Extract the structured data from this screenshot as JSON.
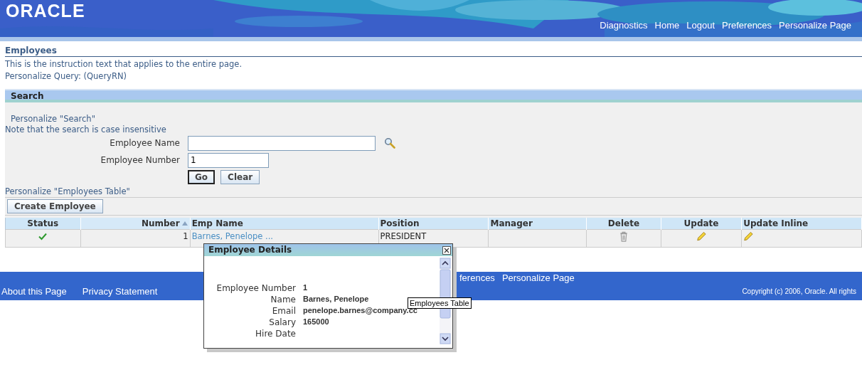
{
  "header": {
    "logo": "ORACLE",
    "links": [
      "Diagnostics",
      "Home",
      "Logout",
      "Preferences",
      "Personalize Page"
    ]
  },
  "page": {
    "title": "Employees",
    "instruction": "This is the instruction text that applies to the entire page.",
    "personalize_query": "Personalize Query: (QueryRN)"
  },
  "search": {
    "title": "Search",
    "personalize": "Personalize \"Search\"",
    "note": "Note that the search is case insensitive",
    "fields": [
      {
        "label": "Employee Name",
        "kind": "lookup"
      },
      {
        "label": "Employee Number",
        "value": "1",
        "kind": "text"
      }
    ],
    "buttons": [
      {
        "label": "Go",
        "default": true
      },
      {
        "label": "Clear",
        "default": false
      }
    ]
  },
  "table": {
    "personalize": "Personalize \"Employees Table\"",
    "create_button": "Create Employee",
    "columns": [
      {
        "label": "Status",
        "sorted": false
      },
      {
        "label": "Number",
        "sorted": true
      },
      {
        "label": "Emp Name",
        "sorted": false
      },
      {
        "label": "Position",
        "sorted": false
      },
      {
        "label": "Manager",
        "sorted": false
      },
      {
        "label": "Delete",
        "sorted": false
      },
      {
        "label": "Update",
        "sorted": false
      },
      {
        "label": "Update Inline",
        "sorted": false
      }
    ],
    "rows": [
      {
        "status": true,
        "number": "1",
        "emp_name": "Barnes, Penelope ...",
        "position": "PRESIDENT",
        "manager": ""
      }
    ]
  },
  "footer": {
    "links": [
      "ferences",
      "Personalize Page"
    ],
    "bottom_links": [
      "About this Page",
      "Privacy Statement"
    ],
    "copyright": "Copyright (c) 2006, Oracle. All rights"
  },
  "popup": {
    "title": "Employee Details",
    "fields": [
      {
        "label": "Employee Number",
        "value": "1"
      },
      {
        "label": "Name",
        "value": "Barnes, Penelope"
      },
      {
        "label": "Email",
        "value": "penelope.barnes@company.cc"
      },
      {
        "label": "Salary",
        "value": "165000"
      },
      {
        "label": "Hire Date"
      }
    ]
  },
  "tooltip": "Employees Table"
}
